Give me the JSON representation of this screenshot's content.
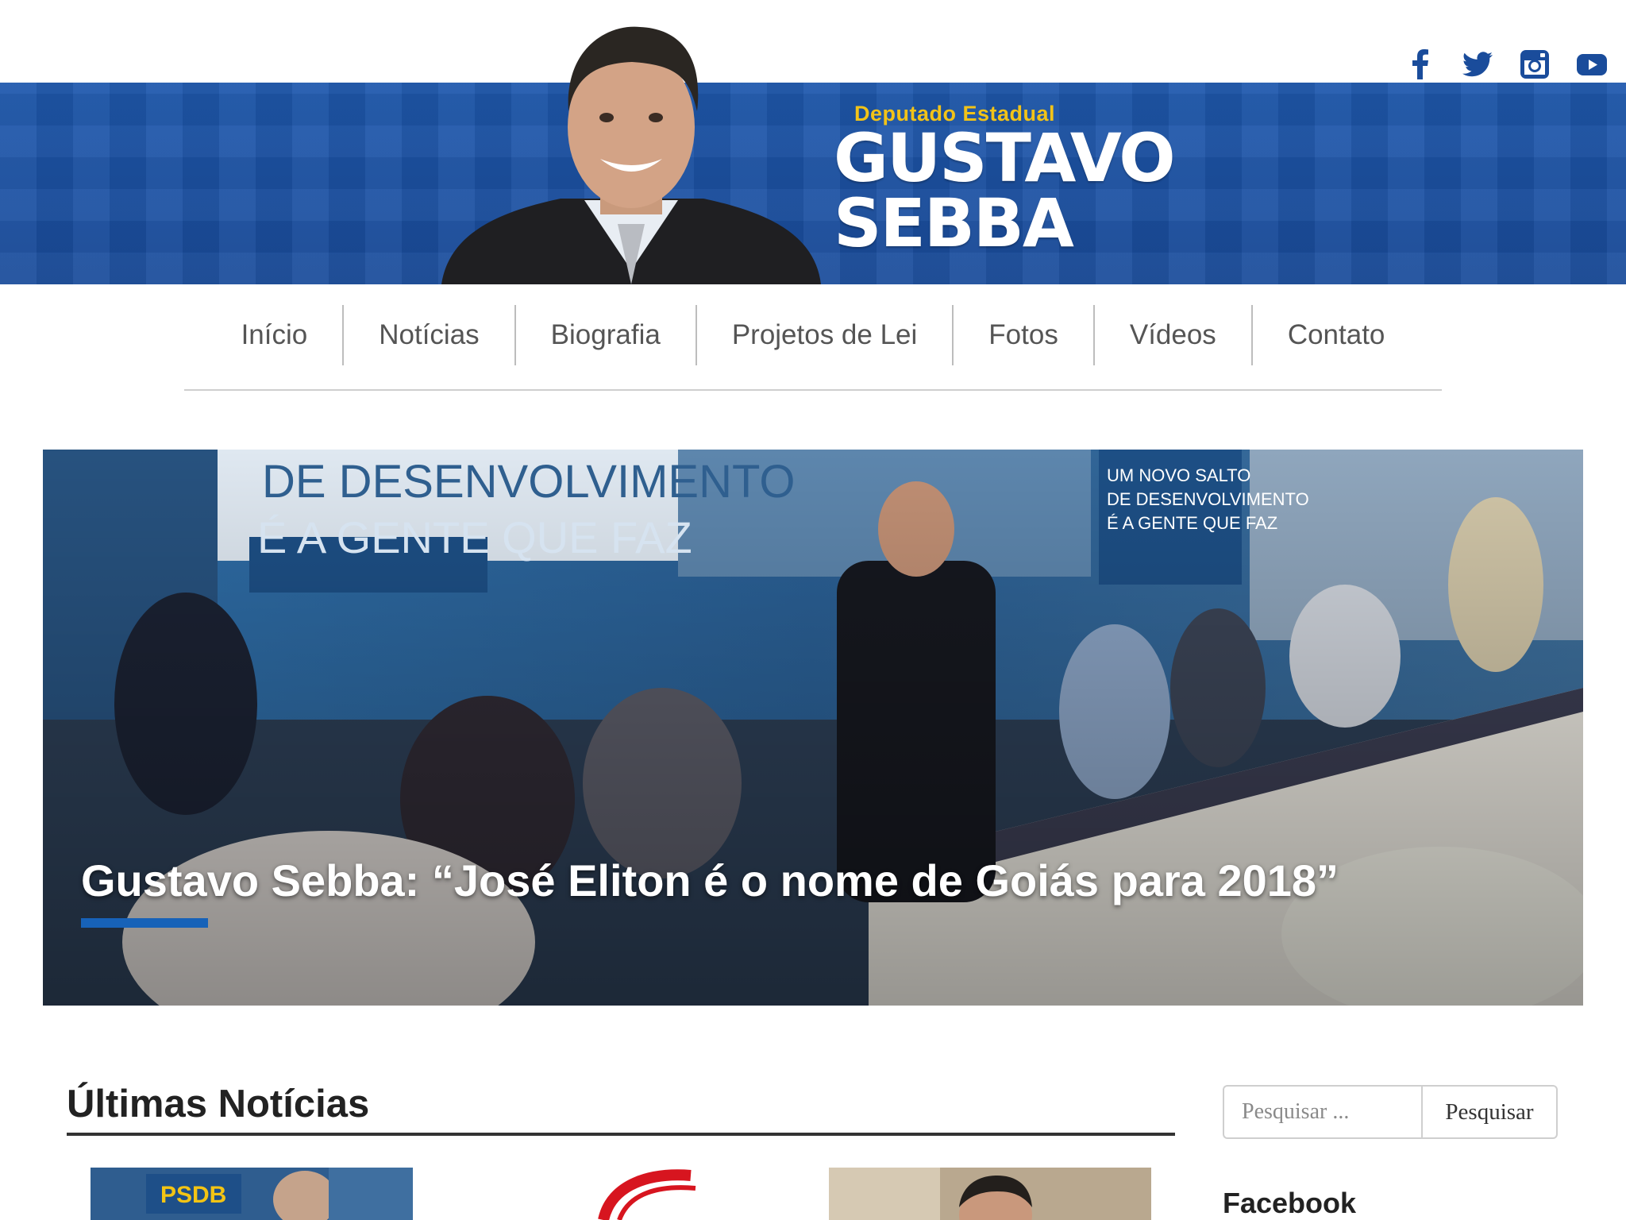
{
  "header": {
    "subtitle": "Deputado Estadual",
    "name_line1": "GUSTAVO",
    "name_line2": "SEBBA",
    "brand_color": "#1e58ad",
    "accent_color": "#f2c318",
    "social": [
      {
        "name": "facebook",
        "icon": "facebook-icon"
      },
      {
        "name": "twitter",
        "icon": "twitter-icon"
      },
      {
        "name": "instagram",
        "icon": "instagram-icon"
      },
      {
        "name": "youtube",
        "icon": "youtube-icon"
      }
    ]
  },
  "nav": {
    "items": [
      "Início",
      "Notícias",
      "Biografia",
      "Projetos de Lei",
      "Fotos",
      "Vídeos",
      "Contato"
    ]
  },
  "hero": {
    "title": "Gustavo Sebba: “José Eliton é o nome de Goiás para 2018”",
    "banner_text_1": "DE DESENVOLVIMENTO",
    "banner_text_2": "É A GENTE QUE FAZ",
    "banner_text_3": "UM NOVO SALTO",
    "banner_text_4": "DE DESENVOLVIMENTO",
    "banner_text_5": "É A GENTE QUE FAZ",
    "accent_color": "#1762b8"
  },
  "latest": {
    "title": "Últimas Notícias",
    "thumb_label": "PSDB"
  },
  "sidebar": {
    "search_placeholder": "Pesquisar ...",
    "search_button": "Pesquisar",
    "facebook_title": "Facebook"
  }
}
